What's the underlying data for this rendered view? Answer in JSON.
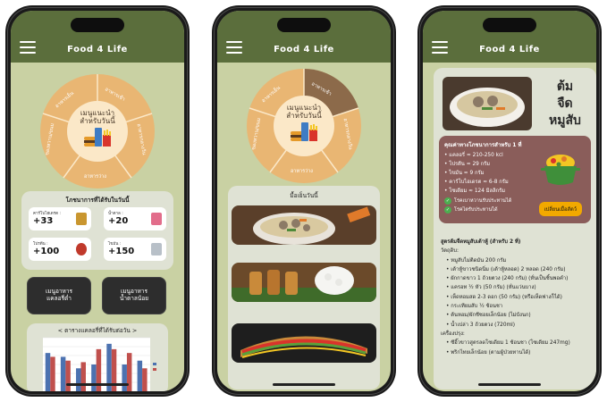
{
  "app": {
    "title": "Food 4 Life"
  },
  "colors": {
    "appbar": "#5b6e3c",
    "screen_bg": "#c9d1a3",
    "wheel_orange": "#e9b673",
    "wheel_dark": "#8c6a4a",
    "accent_yellow": "#f2a900",
    "nutri_box": "#8a5d5a"
  },
  "wheel": {
    "center_title_line1": "เมนูแนะนำ",
    "center_title_line2": "สำหรับวันนี้",
    "segments": [
      "อาหารเย็น",
      "อาหารเช้า",
      "อาหารกลางวัน",
      "อาหารว่าง",
      "ของหวาน/ขนม"
    ]
  },
  "screen1": {
    "nutrition_card_title": "โภชนาการที่ได้รับในวันนี้",
    "stats": [
      {
        "label": "คาร์โบไฮเดรต :",
        "value": "+33"
      },
      {
        "label": "น้ำตาล :",
        "value": "+20"
      },
      {
        "label": "โปรตีน :",
        "value": "+100"
      },
      {
        "label": "ไขมัน :",
        "value": "+150"
      }
    ],
    "menu_buttons": [
      {
        "line1": "เมนูอาหาร",
        "line2": "แคลอรี่ต่ำ"
      },
      {
        "line1": "เมนูอาหาร",
        "line2": "น้ำตาลน้อย"
      }
    ],
    "calorie_card_title": "< ตารางแคลอรี่ที่ได้รับต่อวัน >"
  },
  "chart_data": {
    "type": "bar",
    "categories": [
      "1",
      "2",
      "3",
      "4",
      "5",
      "6",
      "7"
    ],
    "series": [
      {
        "name": "",
        "values": [
          50,
          45,
          30,
          35,
          62,
          35,
          40
        ]
      },
      {
        "name": "",
        "values": [
          45,
          40,
          38,
          55,
          55,
          50,
          30
        ]
      }
    ],
    "ylim": [
      0,
      70
    ],
    "colors": [
      "#4c72b0",
      "#c0504d"
    ]
  },
  "screen2": {
    "list_title": "มื้อเย็นวันนี้",
    "foods": [
      "food-soup",
      "food-satay",
      "food-sandwich"
    ]
  },
  "screen3": {
    "dish_title_line1": "ต้ม",
    "dish_title_line2": "จืด",
    "dish_title_line3": "หมูสับ",
    "nutri_heading": "คุณค่าทางโภชนาการสำหรับ 1 ที่",
    "nutri_items": [
      "แคลอรี่ ≈ 210-250 kcl",
      "โปรตีน ≈ 29 กรัม",
      "ไขมัน ≈ 9 กรัม",
      "คาร์โบไฮเดรต ≈ 6-8 กรัม",
      "โซเดียม ≈ 124 มิลลิกรัม"
    ],
    "checks": [
      "โรคเบาหวานรับประทานได้",
      "โรคไตรับประทานได้"
    ],
    "swap_button": "เปลี่ยนเมื่อสัตว์",
    "recipe_heading": "สูตรต้มจืดหมูสับเต้าหู้ (สำหรับ 2 ที่)",
    "ingredients_label": "วัตถุดิบ:",
    "ingredients": [
      "หมูสับไม่ติดมัน 200 กรัม",
      "เต้าหู้ขาวชนิดนิ่ม (เต้าหู้หลอด) 2 หลอด (240 กรัม)",
      "ผักกาดขาว 1 ถ้วยตวง (240 กรัม) (หั่นเป็นชิ้นพอคำ)",
      "แครอท ½ หัว (50 กรัม) (หั่นแว่นบาง)",
      "เห็ดหอมสด 2-3 ดอก (50 กรัม) (หรือเห็ดฟางก็ได้)",
      "กระเทียมสับ ½ ช้อนชา",
      "ต้นหอม/ผักชีซอยเล็กน้อย (ไม่บังนก)",
      "น้ำเปล่า 3 ถ้วยตวง (720ml)"
    ],
    "seasoning_label": "เครื่องปรุง:",
    "seasonings": [
      "ซีอิ๊วขาวสูตรลดโซเดียม 1 ช้อนชา (โซเดียม 247mg)",
      "พริกไทยเล็กน้อย (ตามผู้ป่วยทานได้)"
    ]
  }
}
